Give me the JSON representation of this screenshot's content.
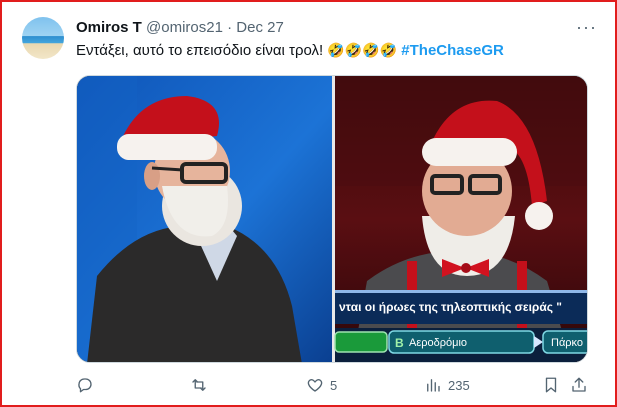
{
  "tweet": {
    "author_name": "Omiros T",
    "handle": "@omiros21",
    "separator": "·",
    "date": "Dec 27",
    "more_label": "···",
    "text": "Εντάξει, αυτό το επεισόδιο είναι τρολ!",
    "emojis": "🤣🤣🤣🤣",
    "hashtag": "#TheChaseGR"
  },
  "media": {
    "caption_strip": "νται οι ήρωες της τηλεοπτικής σειράς \"",
    "answer_b_letter": "B",
    "answer_b": "Αεροδρόμιο",
    "answer_next": "Πάρκο"
  },
  "actions": {
    "reply_icon": "reply-icon",
    "retweet_icon": "retweet-icon",
    "like_icon": "heart-icon",
    "like_count": "5",
    "views_icon": "views-icon",
    "views_count": "235",
    "bookmark_icon": "bookmark-icon",
    "share_icon": "share-icon"
  },
  "colors": {
    "frame": "#e11d1d",
    "hashtag": "#1d9bf0",
    "muted": "#536471"
  }
}
